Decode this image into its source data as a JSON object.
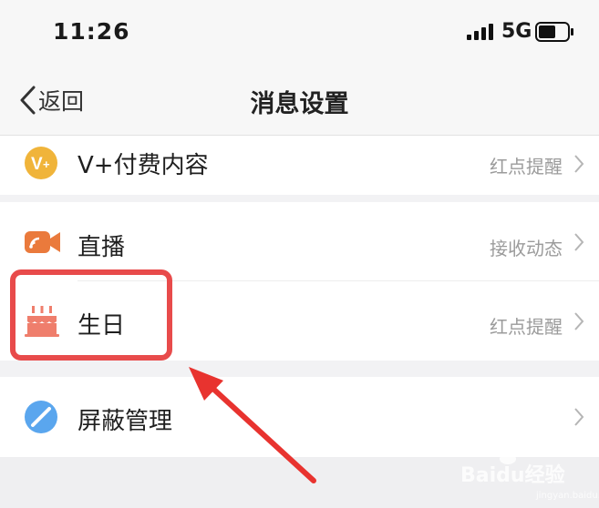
{
  "status_bar": {
    "time": "11:26",
    "network": "5G"
  },
  "nav": {
    "back_label": "返回",
    "title": "消息设置"
  },
  "settings": [
    {
      "label": "V+付费内容",
      "value": "红点提醒",
      "icon": "v-plus-icon",
      "icon_color": "#f0b43a"
    },
    {
      "label": "直播",
      "value": "接收动态",
      "icon": "live-camera-icon",
      "icon_color": "#ea7a3c"
    },
    {
      "label": "生日",
      "value": "红点提醒",
      "icon": "birthday-cake-icon",
      "icon_color": "#ef7e6c"
    },
    {
      "label": "屏蔽管理",
      "value": "",
      "icon": "block-icon",
      "icon_color": "#5aa6ee"
    }
  ],
  "annotation": {
    "highlight_color": "#e84b4b",
    "arrow_color": "#e8332f"
  },
  "watermark": {
    "text": "Baidu经验",
    "sub": "jingyan.baidu.com"
  }
}
